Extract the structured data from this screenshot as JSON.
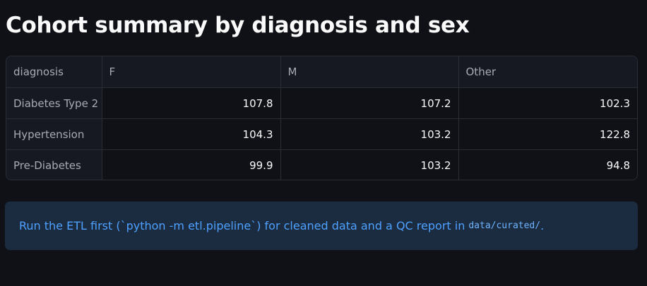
{
  "page": {
    "title": "Cohort summary by diagnosis and sex"
  },
  "table": {
    "columns": [
      "diagnosis",
      "F",
      "M",
      "Other"
    ],
    "rows": [
      {
        "diagnosis": "Diabetes Type 2",
        "F": "107.8",
        "M": "107.2",
        "Other": "102.3"
      },
      {
        "diagnosis": "Hypertension",
        "F": "104.3",
        "M": "103.2",
        "Other": "122.8"
      },
      {
        "diagnosis": "Pre-Diabetes",
        "F": "99.9",
        "M": "103.2",
        "Other": "94.8"
      }
    ]
  },
  "info": {
    "text": "Run the ETL first (`python -m etl.pipeline`) for cleaned data and a QC report in",
    "code": "data/curated/",
    "suffix": "."
  },
  "colors": {
    "background": "#0f1117",
    "info_background": "#1b2b40",
    "info_text": "#4ea1ff"
  }
}
